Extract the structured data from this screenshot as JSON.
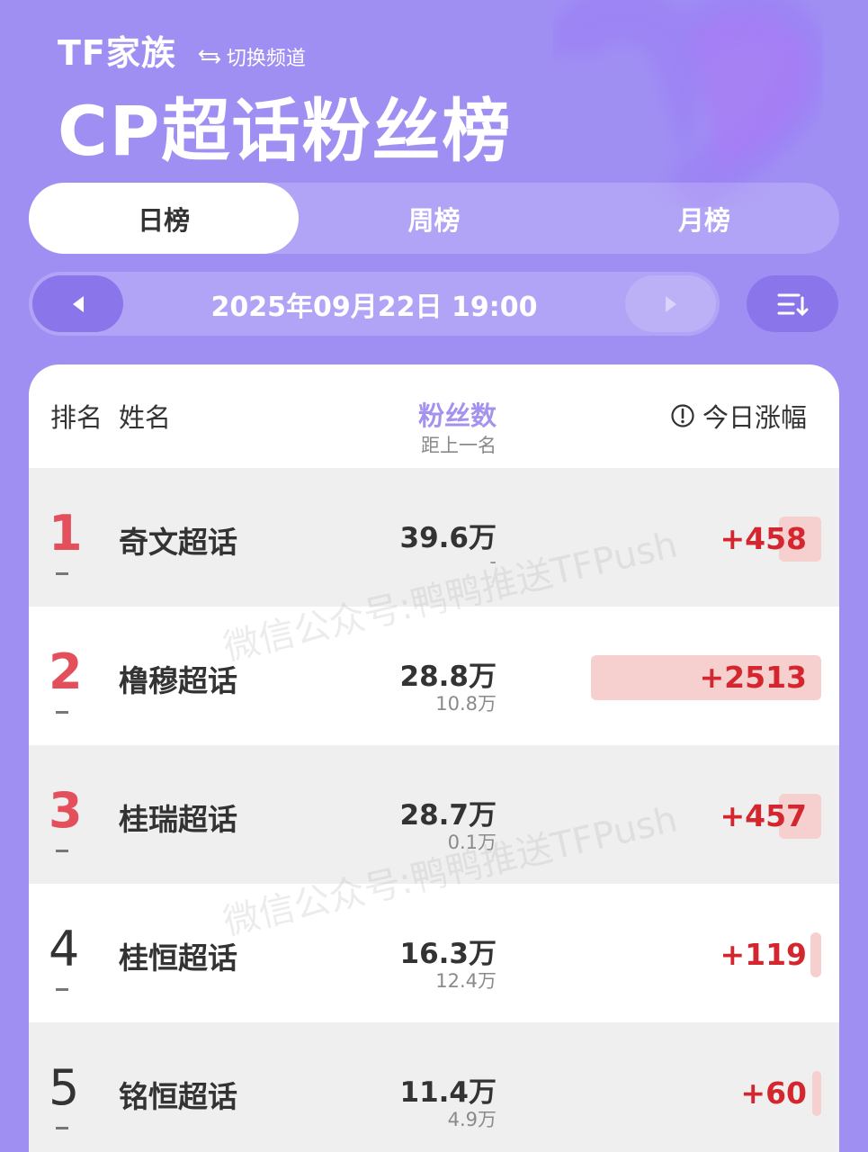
{
  "header": {
    "channel_name": "TF家族",
    "switch_label": "切换频道",
    "page_title": "CP超话粉丝榜"
  },
  "tabs": [
    {
      "label": "日榜",
      "active": true
    },
    {
      "label": "周榜",
      "active": false
    },
    {
      "label": "月榜",
      "active": false
    }
  ],
  "date_bar": {
    "datetime": "2025年09月22日 19:00",
    "prev_icon": "chevron-left-icon",
    "next_icon": "chevron-right-icon",
    "sort_icon": "sort-icon"
  },
  "table": {
    "columns": {
      "rank": "排名",
      "name": "姓名",
      "fans": "粉丝数",
      "gap": "距上一名",
      "growth": "今日涨幅"
    },
    "rows": [
      {
        "rank": "1",
        "name": "奇文超话",
        "fans": "39.6万",
        "gap": "-",
        "growth": "+458",
        "growth_value": 458
      },
      {
        "rank": "2",
        "name": "橹穆超话",
        "fans": "28.8万",
        "gap": "10.8万",
        "growth": "+2513",
        "growth_value": 2513
      },
      {
        "rank": "3",
        "name": "桂瑞超话",
        "fans": "28.7万",
        "gap": "0.1万",
        "growth": "+457",
        "growth_value": 457
      },
      {
        "rank": "4",
        "name": "桂恒超话",
        "fans": "16.3万",
        "gap": "12.4万",
        "growth": "+119",
        "growth_value": 119
      },
      {
        "rank": "5",
        "name": "铭恒超话",
        "fans": "11.4万",
        "gap": "4.9万",
        "growth": "+60",
        "growth_value": 60
      }
    ]
  },
  "watermark": "微信公众号:鸭鸭推送TFPush",
  "colors": {
    "background": "#a08ff3",
    "accent": "#8b75ea",
    "top_rank": "#e3505c",
    "growth_text": "#d4262e",
    "growth_bar": "#f6cfcf"
  }
}
